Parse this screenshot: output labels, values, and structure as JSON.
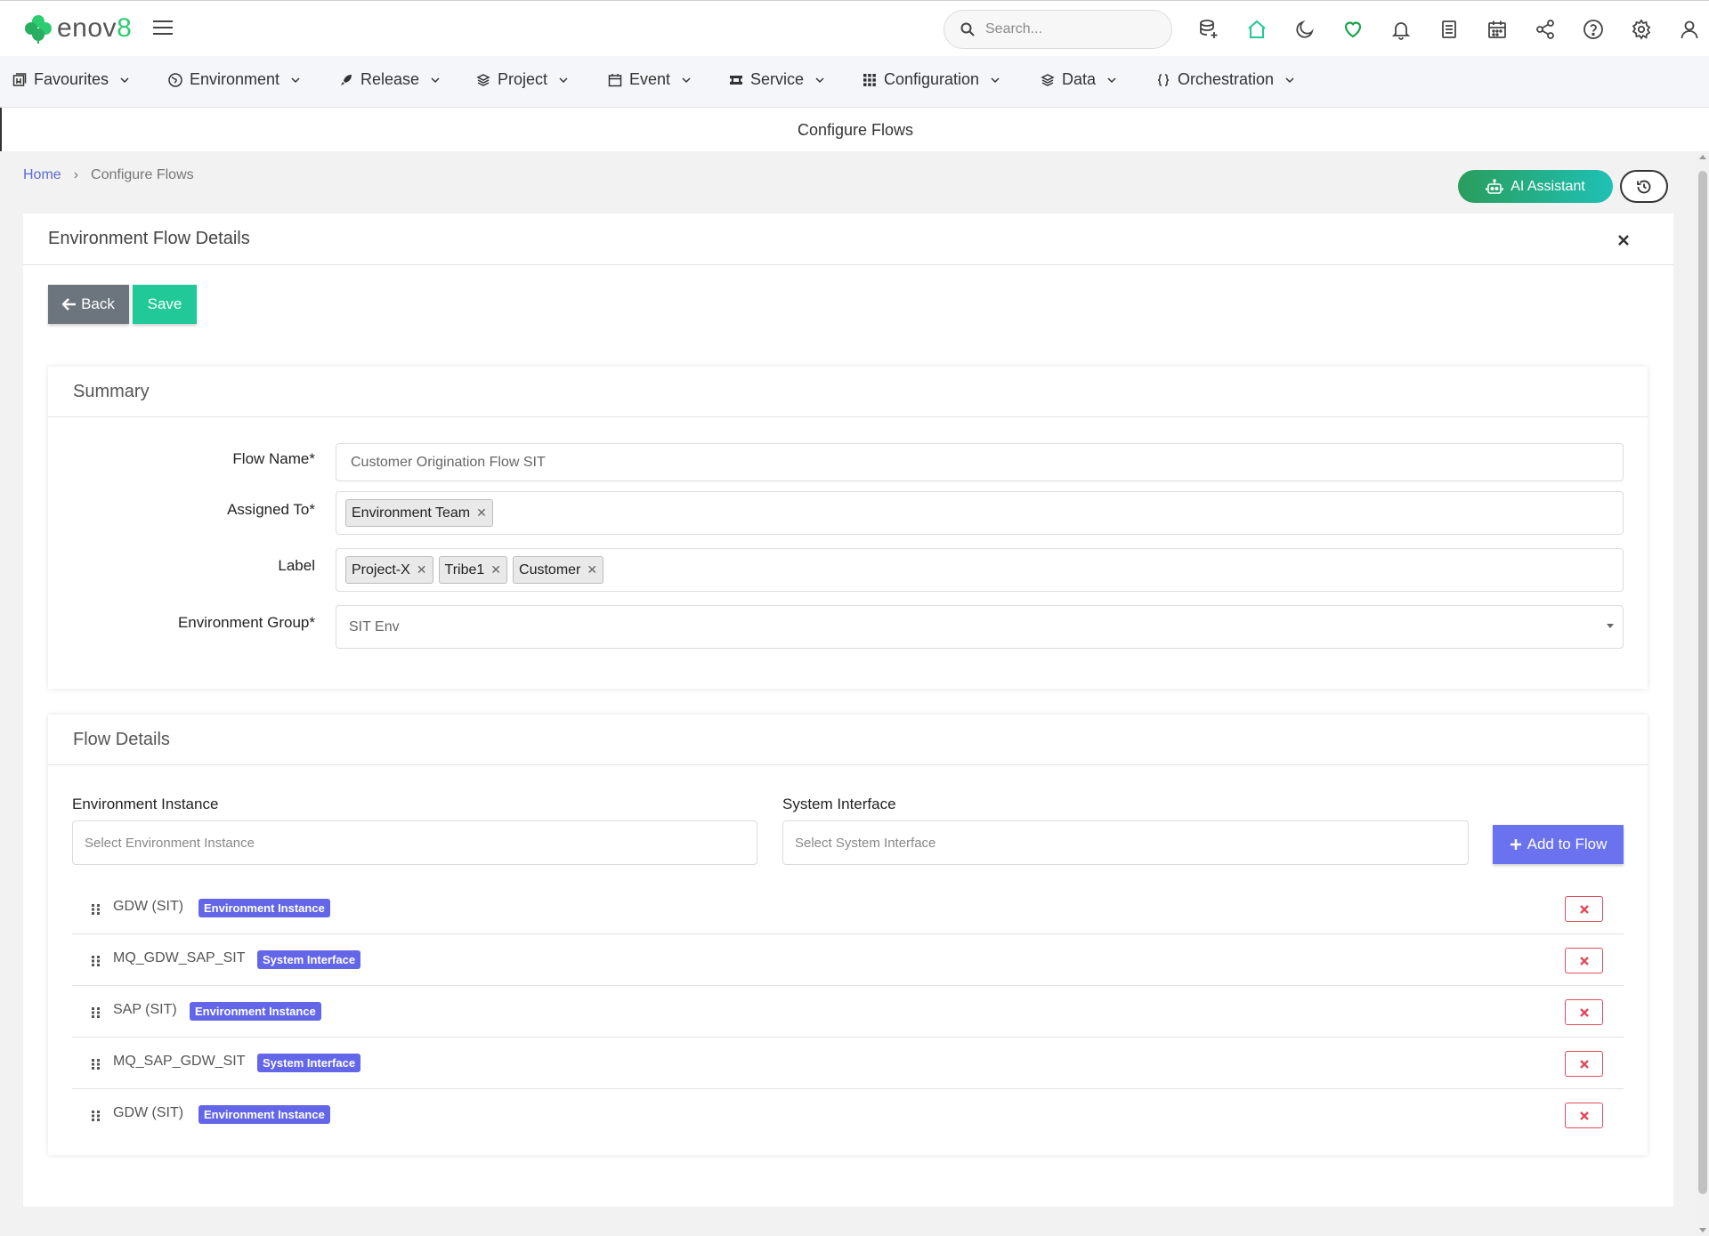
{
  "app": {
    "logo_text": "enov",
    "logo_suffix": "8"
  },
  "search": {
    "placeholder": "Search..."
  },
  "top_icons": [
    "database-add-icon",
    "home-icon",
    "moon-icon",
    "heart-icon",
    "bell-icon",
    "document-icon",
    "calendar-icon",
    "share-icon",
    "help-icon",
    "settings-icon",
    "user-icon"
  ],
  "menu": {
    "items": [
      {
        "label": "Favourites",
        "icon": "bookmark-icon"
      },
      {
        "label": "Environment",
        "icon": "globe-icon"
      },
      {
        "label": "Release",
        "icon": "rocket-icon"
      },
      {
        "label": "Project",
        "icon": "layers-icon"
      },
      {
        "label": "Event",
        "icon": "calendar-icon"
      },
      {
        "label": "Service",
        "icon": "ticket-icon"
      },
      {
        "label": "Configuration",
        "icon": "grid-icon"
      },
      {
        "label": "Data",
        "icon": "layers-icon"
      },
      {
        "label": "Orchestration",
        "icon": "braces-icon"
      }
    ]
  },
  "page": {
    "title": "Configure Flows"
  },
  "breadcrumb": {
    "home": "Home",
    "separator": "›",
    "current": "Configure Flows"
  },
  "actions": {
    "ai_assistant": "AI Assistant"
  },
  "card": {
    "title": "Environment Flow Details",
    "back_label": "Back",
    "save_label": "Save"
  },
  "summary": {
    "title": "Summary",
    "flow_name_label": "Flow Name*",
    "flow_name_value": "Customer Origination Flow SIT",
    "assigned_to_label": "Assigned To*",
    "assigned_to_tags": [
      "Environment Team"
    ],
    "label_label": "Label",
    "label_tags": [
      "Project-X",
      "Tribe1",
      "Customer"
    ],
    "env_group_label": "Environment Group*",
    "env_group_value": "SIT Env"
  },
  "flow": {
    "title": "Flow Details",
    "env_instance_label": "Environment Instance",
    "env_instance_placeholder": "Select Environment Instance",
    "sys_interface_label": "System Interface",
    "sys_interface_placeholder": "Select System Interface",
    "add_label": "Add to Flow",
    "rows": [
      {
        "name": "GDW (SIT)",
        "badge": "Environment Instance"
      },
      {
        "name": "MQ_GDW_SAP_SIT",
        "badge": "System Interface"
      },
      {
        "name": "SAP (SIT)",
        "badge": "Environment Instance"
      },
      {
        "name": "MQ_SAP_GDW_SIT",
        "badge": "System Interface"
      },
      {
        "name": "GDW (SIT)",
        "badge": "Environment Instance"
      }
    ]
  },
  "colors": {
    "accent": "#6366e8",
    "save": "#20c997",
    "back": "#6c757d",
    "danger": "#e04b5a",
    "ai_gradient_start": "#2a9d5c",
    "ai_gradient_end": "#1ec1b5"
  }
}
